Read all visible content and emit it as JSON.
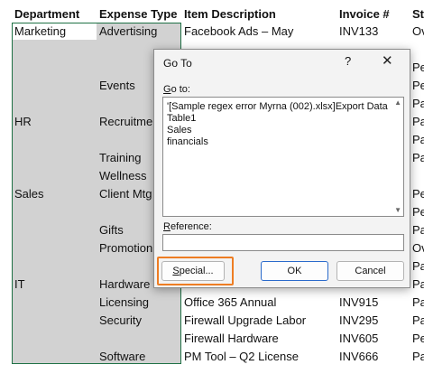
{
  "headers": [
    "Department",
    "Expense Type",
    "Item Description",
    "Invoice #",
    "Sta"
  ],
  "departments": [
    "Marketing",
    "HR",
    "Sales",
    "IT"
  ],
  "expense_types": [
    "Advertising",
    "Events",
    "Recruitme",
    "Training",
    "Wellness",
    "Client Mtg",
    "Gifts",
    "Promotion",
    "Hardware",
    "Licensing",
    "Security",
    "Software"
  ],
  "items": [
    "Facebook Ads – May",
    "Office 365 Annual",
    "Firewall Upgrade Labor",
    "Firewall Hardware",
    "PM Tool – Q2 License"
  ],
  "invoices": [
    "INV133",
    "INV915",
    "INV295",
    "INV605",
    "INV666"
  ],
  "status": [
    "Ov",
    "Pe",
    "Pe",
    "Pa",
    "Pa",
    "Pa",
    "Pa",
    "Pe",
    "Pe",
    "Pa",
    "Ov",
    "Pa",
    "Pa",
    "Pa",
    "Pa",
    "Pe",
    "Pa",
    "Ov",
    "Pa"
  ],
  "dialog": {
    "title": "Go To",
    "help": "?",
    "close": "✕",
    "goto_label_prefix": "G",
    "goto_label_rest": "o to:",
    "list_items": [
      "'[Sample regex error Myrna (002).xlsx]Export Data",
      "Table1",
      "Sales",
      "financials"
    ],
    "reference_label_prefix": "R",
    "reference_label_rest": "eference:",
    "reference_value": "",
    "special_prefix": "S",
    "special_rest": "pecial...",
    "ok": "OK",
    "cancel": "Cancel"
  },
  "colors": {
    "selection_border": "#1e7145",
    "highlight": "#ee7d23",
    "ok_border": "#2a6acb"
  }
}
